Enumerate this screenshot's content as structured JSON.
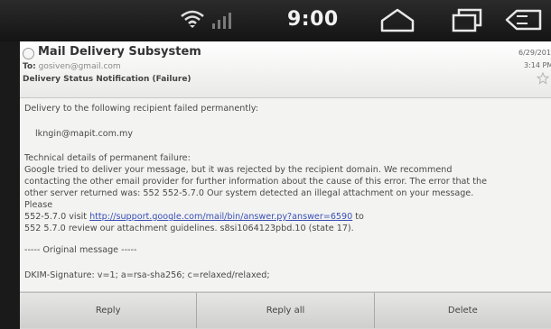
{
  "statusbar": {
    "time": "9:00",
    "icons": [
      "wifi-icon",
      "signal-icon",
      "home-icon",
      "recent-apps-icon",
      "back-icon"
    ]
  },
  "email": {
    "sender": "Mail Delivery Subsystem",
    "to_label": "To:",
    "to_value": "gosiven@gmail.com",
    "subject": "Delivery Status Notification (Failure)",
    "date": "6/29/2012",
    "time": "3:14 PM",
    "body": {
      "line1": "Delivery to the following recipient failed permanently:",
      "recipient": "lkngin@mapit.com.my",
      "technical": [
        "Technical details of permanent failure:",
        "Google tried to deliver your message, but it was rejected by the recipient domain. We recommend",
        "contacting the other email provider for further information about the cause of this error. The error that the",
        "other server returned was: 552 552-5.7.0 Our system detected an illegal attachment on your message.",
        "Please"
      ],
      "link_prefix": "552-5.7.0 visit ",
      "link_text": "http://support.google.com/mail/bin/answer.py?answer=6590",
      "link_suffix": " to",
      "after_link": "552 5.7.0 review our attachment guidelines. s8si1064123pbd.10 (state 17).",
      "separator": "----- Original message -----",
      "dkim": "DKIM-Signature: v=1; a=rsa-sha256; c=relaxed/relaxed;"
    }
  },
  "buttons": {
    "reply": "Reply",
    "reply_all": "Reply all",
    "delete": "Delete"
  }
}
